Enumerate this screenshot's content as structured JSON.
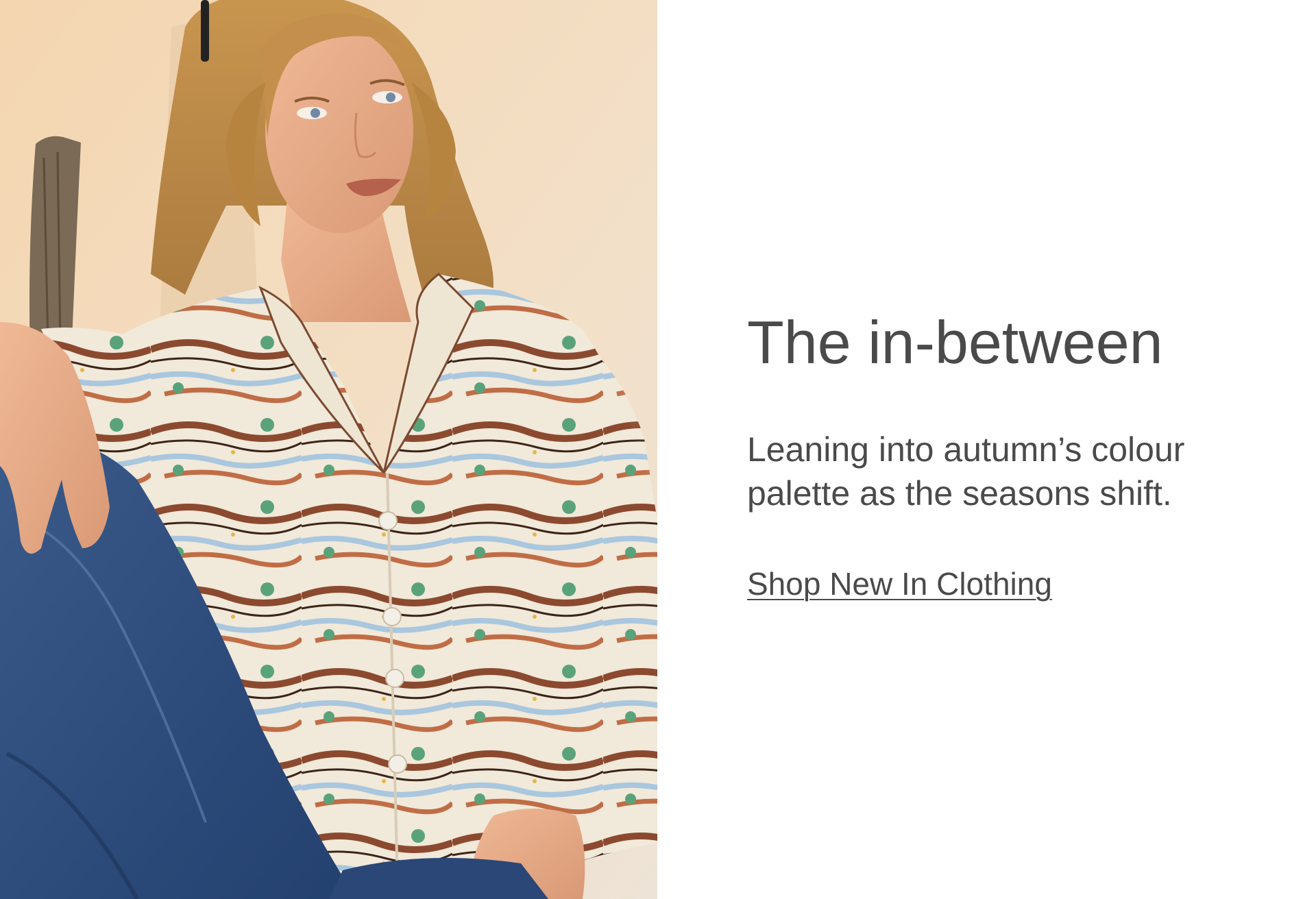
{
  "hero": {
    "image_alt": "Woman with wavy blonde hair wearing a landscape-print shirt and denim jeans",
    "headline": "The in-between",
    "subhead": "Leaning into autumn’s colour palette as the seasons shift.",
    "cta_label": "Shop New In Clothing"
  },
  "colors": {
    "text": "#4a4a4a",
    "background": "#ffffff",
    "photo_backdrop": "#f2dcc0"
  }
}
